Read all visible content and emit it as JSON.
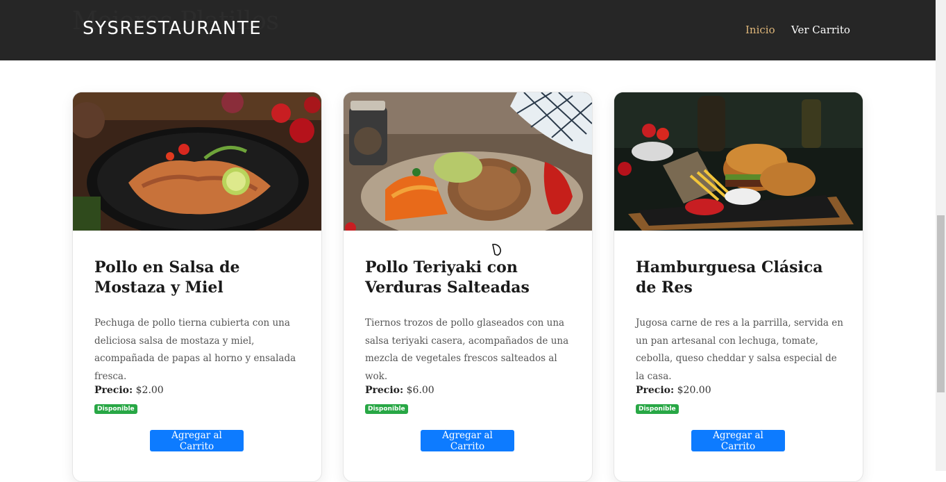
{
  "navbar": {
    "ghost_title": "Mejores Platillos",
    "brand": "SYSRESTAURANTE",
    "links": [
      "Inicio",
      "Ver Carrito"
    ]
  },
  "products": [
    {
      "title": "Pollo en Salsa de Mostaza y Miel",
      "description": "Pechuga de pollo tierna cubierta con una deliciosa salsa de mostaza y miel, acompañada de papas al horno y ensalada fresca.",
      "price_label": "Precio:",
      "price": "$2.00",
      "status": "Disponible",
      "button": "Agregar al Carrito",
      "image_icon": "chicken-plate-photo"
    },
    {
      "title": "Pollo Teriyaki con Verduras Salteadas",
      "description": "Tiernos trozos de pollo glaseados con una salsa teriyaki casera, acompañados de una mezcla de vegetales frescos salteados al wok.",
      "price_label": "Precio:",
      "price": "$6.00",
      "status": "Disponible",
      "button": "Agregar al Carrito",
      "image_icon": "teriyaki-plate-photo"
    },
    {
      "title": "Hamburguesa Clásica de Res",
      "description": "Jugosa carne de res a la parrilla, servida en un pan artesanal con lechuga, tomate, cebolla, queso cheddar y salsa especial de la casa.",
      "price_label": "Precio:",
      "price": "$20.00",
      "status": "Disponible",
      "button": "Agregar al Carrito",
      "image_icon": "burger-board-photo"
    }
  ],
  "colors": {
    "navbar_bg": "#262626",
    "nav_active": "#e0b77a",
    "button": "#0d7bff",
    "badge": "#28a745"
  }
}
